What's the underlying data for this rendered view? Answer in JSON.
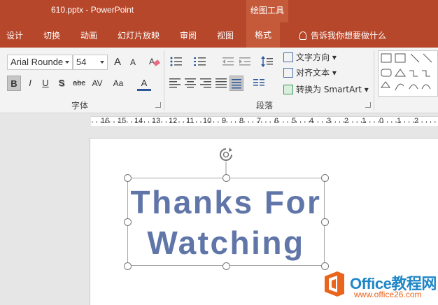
{
  "window": {
    "file_title": "610.pptx  -  PowerPoint",
    "context_tab_group": "绘图工具"
  },
  "menu": {
    "tabs": [
      "设计",
      "切换",
      "动画",
      "幻灯片放映",
      "审阅",
      "视图",
      "格式"
    ],
    "active_tab": "格式",
    "tell_me": "告诉我你想要做什么"
  },
  "font_group": {
    "font_name": "Arial Rounde",
    "font_size": "54",
    "grow_label": "A",
    "shrink_label": "A",
    "bold_label": "B",
    "italic_label": "I",
    "underline_label": "U",
    "shadow_label": "S",
    "strike_label": "abc",
    "spacing_label": "AV",
    "case_label": "Aa",
    "color_label": "A",
    "label": "字体"
  },
  "paragraph_group": {
    "text_direction": "文字方向",
    "align_text": "对齐文本",
    "convert_smartart": "转换为 SmartArt",
    "label": "段落"
  },
  "ruler": {
    "labels": [
      "16",
      "15",
      "14",
      "13",
      "12",
      "11",
      "10",
      "9",
      "8",
      "7",
      "6",
      "5",
      "4",
      "3",
      "2",
      "1",
      "0",
      "1",
      "2"
    ]
  },
  "slide": {
    "line1": "Thanks For",
    "line2": "Watching",
    "text_color": "#6076a8"
  },
  "watermark": {
    "title": "Office教程网",
    "url": "www.office26.com"
  },
  "colors": {
    "accent": "#b7472a",
    "context_tab": "#c55a3b",
    "ribbon_bg": "#f3f3f3"
  }
}
